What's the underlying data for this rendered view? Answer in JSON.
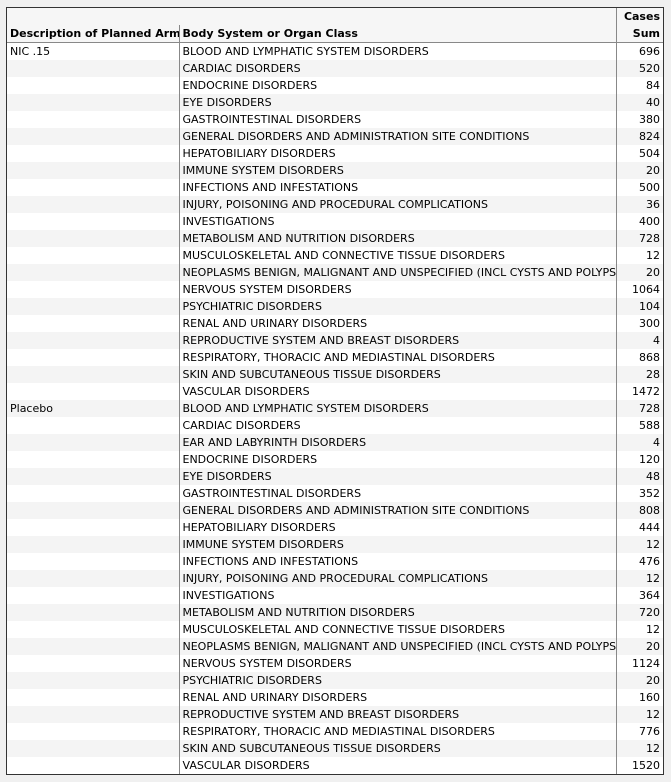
{
  "table": {
    "header_group": "Cases",
    "columns": [
      "Description of Planned Arm",
      "Body System or Organ Class",
      "Sum"
    ],
    "groups": [
      {
        "arm": "NIC .15",
        "rows": [
          {
            "organ_class": "BLOOD AND LYMPHATIC SYSTEM DISORDERS",
            "sum": "696"
          },
          {
            "organ_class": "CARDIAC DISORDERS",
            "sum": "520"
          },
          {
            "organ_class": "ENDOCRINE DISORDERS",
            "sum": "84"
          },
          {
            "organ_class": "EYE DISORDERS",
            "sum": "40"
          },
          {
            "organ_class": "GASTROINTESTINAL DISORDERS",
            "sum": "380"
          },
          {
            "organ_class": "GENERAL DISORDERS AND ADMINISTRATION SITE CONDITIONS",
            "sum": "824"
          },
          {
            "organ_class": "HEPATOBILIARY DISORDERS",
            "sum": "504"
          },
          {
            "organ_class": "IMMUNE SYSTEM DISORDERS",
            "sum": "20"
          },
          {
            "organ_class": "INFECTIONS AND INFESTATIONS",
            "sum": "500"
          },
          {
            "organ_class": "INJURY, POISONING AND PROCEDURAL COMPLICATIONS",
            "sum": "36"
          },
          {
            "organ_class": "INVESTIGATIONS",
            "sum": "400"
          },
          {
            "organ_class": "METABOLISM AND NUTRITION DISORDERS",
            "sum": "728"
          },
          {
            "organ_class": "MUSCULOSKELETAL AND CONNECTIVE TISSUE DISORDERS",
            "sum": "12"
          },
          {
            "organ_class": "NEOPLASMS BENIGN, MALIGNANT AND UNSPECIFIED (INCL CYSTS AND POLYPS)",
            "sum": "20"
          },
          {
            "organ_class": "NERVOUS SYSTEM DISORDERS",
            "sum": "1064"
          },
          {
            "organ_class": "PSYCHIATRIC DISORDERS",
            "sum": "104"
          },
          {
            "organ_class": "RENAL AND URINARY DISORDERS",
            "sum": "300"
          },
          {
            "organ_class": "REPRODUCTIVE SYSTEM AND BREAST DISORDERS",
            "sum": "4"
          },
          {
            "organ_class": "RESPIRATORY, THORACIC AND MEDIASTINAL DISORDERS",
            "sum": "868"
          },
          {
            "organ_class": "SKIN AND SUBCUTANEOUS TISSUE DISORDERS",
            "sum": "28"
          },
          {
            "organ_class": "VASCULAR DISORDERS",
            "sum": "1472"
          }
        ]
      },
      {
        "arm": "Placebo",
        "rows": [
          {
            "organ_class": "BLOOD AND LYMPHATIC SYSTEM DISORDERS",
            "sum": "728"
          },
          {
            "organ_class": "CARDIAC DISORDERS",
            "sum": "588"
          },
          {
            "organ_class": "EAR AND LABYRINTH DISORDERS",
            "sum": "4"
          },
          {
            "organ_class": "ENDOCRINE DISORDERS",
            "sum": "120"
          },
          {
            "organ_class": "EYE DISORDERS",
            "sum": "48"
          },
          {
            "organ_class": "GASTROINTESTINAL DISORDERS",
            "sum": "352"
          },
          {
            "organ_class": "GENERAL DISORDERS AND ADMINISTRATION SITE CONDITIONS",
            "sum": "808"
          },
          {
            "organ_class": "HEPATOBILIARY DISORDERS",
            "sum": "444"
          },
          {
            "organ_class": "IMMUNE SYSTEM DISORDERS",
            "sum": "12"
          },
          {
            "organ_class": "INFECTIONS AND INFESTATIONS",
            "sum": "476"
          },
          {
            "organ_class": "INJURY, POISONING AND PROCEDURAL COMPLICATIONS",
            "sum": "12"
          },
          {
            "organ_class": "INVESTIGATIONS",
            "sum": "364"
          },
          {
            "organ_class": "METABOLISM AND NUTRITION DISORDERS",
            "sum": "720"
          },
          {
            "organ_class": "MUSCULOSKELETAL AND CONNECTIVE TISSUE DISORDERS",
            "sum": "12"
          },
          {
            "organ_class": "NEOPLASMS BENIGN, MALIGNANT AND UNSPECIFIED (INCL CYSTS AND POLYPS)",
            "sum": "20"
          },
          {
            "organ_class": "NERVOUS SYSTEM DISORDERS",
            "sum": "1124"
          },
          {
            "organ_class": "PSYCHIATRIC DISORDERS",
            "sum": "20"
          },
          {
            "organ_class": "RENAL AND URINARY DISORDERS",
            "sum": "160"
          },
          {
            "organ_class": "REPRODUCTIVE SYSTEM AND BREAST DISORDERS",
            "sum": "12"
          },
          {
            "organ_class": "RESPIRATORY, THORACIC AND MEDIASTINAL DISORDERS",
            "sum": "776"
          },
          {
            "organ_class": "SKIN AND SUBCUTANEOUS TISSUE DISORDERS",
            "sum": "12"
          },
          {
            "organ_class": "VASCULAR DISORDERS",
            "sum": "1520"
          }
        ]
      }
    ]
  }
}
